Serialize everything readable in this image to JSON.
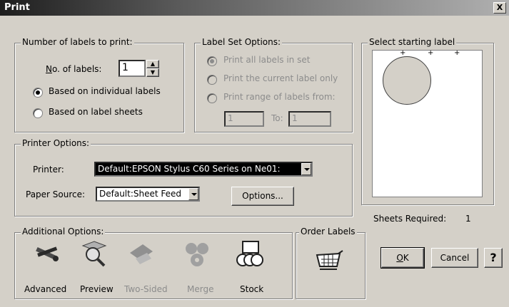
{
  "window": {
    "title": "Print",
    "close_glyph": "X"
  },
  "labels_group": {
    "legend": "Number of labels to print:",
    "count_label": "No. of labels:",
    "count_value": "1",
    "radio_individual": "Based on individual labels",
    "radio_sheets": "Based on label sheets",
    "selected": "individual"
  },
  "labelset_group": {
    "legend": "Label Set Options:",
    "opt_all": "Print all labels in set",
    "opt_current": "Print the current label only",
    "opt_range": "Print range of labels from:",
    "range_from": "1",
    "to_label": "To:",
    "range_to": "1"
  },
  "select_group": {
    "legend": "Select starting label"
  },
  "printer_group": {
    "legend": "Printer Options:",
    "printer_label": "Printer:",
    "printer_value": "Default:EPSON Stylus C60 Series on Ne01:",
    "source_label": "Paper Source:",
    "source_value": "Default:Sheet Feed",
    "options_button": "Options..."
  },
  "sheets_required": {
    "label": "Sheets Required:",
    "value": "1"
  },
  "additional_group": {
    "legend": "Additional Options:",
    "tools": [
      {
        "label": "Advanced",
        "icon": "tools-icon",
        "enabled": true
      },
      {
        "label": "Preview",
        "icon": "magnifier-icon",
        "enabled": true
      },
      {
        "label": "Two-Sided",
        "icon": "two-sided-icon",
        "enabled": false
      },
      {
        "label": "Merge",
        "icon": "merge-icon",
        "enabled": false
      },
      {
        "label": "Stock",
        "icon": "stock-icon",
        "enabled": true
      }
    ]
  },
  "order_group": {
    "legend": "Order Labels",
    "icon": "shopping-cart-icon"
  },
  "buttons": {
    "ok": "OK",
    "cancel": "Cancel",
    "help_glyph": "?"
  }
}
